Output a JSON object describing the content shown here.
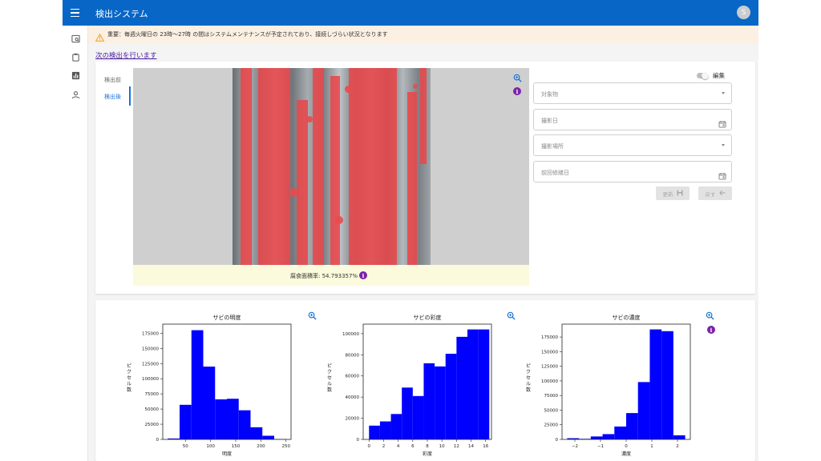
{
  "app": {
    "title": "検出システム",
    "avatar_initial": "S"
  },
  "sidebar": {
    "items": [
      {
        "icon": "image-search-icon"
      },
      {
        "icon": "clipboard-icon"
      },
      {
        "icon": "bar-chart-icon"
      },
      {
        "icon": "person-icon"
      }
    ]
  },
  "banner": {
    "icon": "warning-icon",
    "text": "重要：毎週火曜日の 23時〜27時 の間はシステムメンテナンスが予定されており、接続しづらい状況となります"
  },
  "next_link": "次の検出を行います",
  "tabs": [
    {
      "label": "検出前",
      "active": false
    },
    {
      "label": "検出後",
      "active": true
    }
  ],
  "image_panel": {
    "corrosion_label": "腐食面積率: 54.793357%"
  },
  "form": {
    "edit_toggle_label": "編集",
    "edit_enabled": false,
    "fields": [
      {
        "label": "対象物",
        "type": "select"
      },
      {
        "label": "撮影日",
        "type": "date"
      },
      {
        "label": "撮影場所",
        "type": "select"
      },
      {
        "label": "前回修繕日",
        "type": "date"
      }
    ],
    "update_button": "更新",
    "back_button": "戻す"
  },
  "colors": {
    "accent": "#0866c6",
    "bar": "#0000ff",
    "info": "#7b22a8",
    "rust": "#e8474a"
  },
  "chart_data": [
    {
      "type": "bar",
      "title": "サビの明度",
      "xlabel": "明度",
      "ylabel": "ピクセル数",
      "bins": [
        15,
        38.5,
        62,
        85.5,
        109,
        132.5,
        156,
        179.5,
        203,
        226.5,
        250
      ],
      "values": [
        1500,
        57000,
        180000,
        120000,
        66000,
        67000,
        48000,
        20000,
        6000,
        500
      ],
      "xlim": [
        5,
        260
      ],
      "xticks": [
        50,
        100,
        150,
        200,
        250
      ],
      "ylim": [
        0,
        190000
      ],
      "yticks": [
        0,
        25000,
        50000,
        75000,
        100000,
        125000,
        150000,
        175000
      ]
    },
    {
      "type": "bar",
      "title": "サビの彩度",
      "xlabel": "彩度",
      "ylabel": "ピクセル数",
      "bins": [
        0,
        1.5,
        3,
        4.5,
        6,
        7.5,
        9,
        10.5,
        12,
        13.5,
        15,
        16.5
      ],
      "values": [
        13000,
        17000,
        24000,
        49000,
        41000,
        72000,
        69000,
        81000,
        97000,
        104000,
        104000
      ],
      "xlim": [
        -0.8,
        16.8
      ],
      "xticks": [
        0,
        2,
        4,
        6,
        8,
        10,
        12,
        14,
        16
      ],
      "ylim": [
        0,
        109000
      ],
      "yticks": [
        0,
        20000,
        40000,
        60000,
        80000,
        100000
      ]
    },
    {
      "type": "bar",
      "title": "サビの濃度",
      "xlabel": "濃度",
      "ylabel": "ピクセル数",
      "bins": [
        -2.3,
        -1.84,
        -1.38,
        -0.92,
        -0.46,
        0,
        0.46,
        0.92,
        1.38,
        1.84,
        2.3
      ],
      "values": [
        2000,
        1000,
        5000,
        9000,
        22000,
        45000,
        98000,
        188000,
        185000,
        7000
      ],
      "xlim": [
        -2.5,
        2.5
      ],
      "xticks": [
        -2,
        -1,
        0,
        1,
        2
      ],
      "ylim": [
        0,
        197000
      ],
      "yticks": [
        0,
        25000,
        50000,
        75000,
        100000,
        125000,
        150000,
        175000
      ]
    }
  ]
}
